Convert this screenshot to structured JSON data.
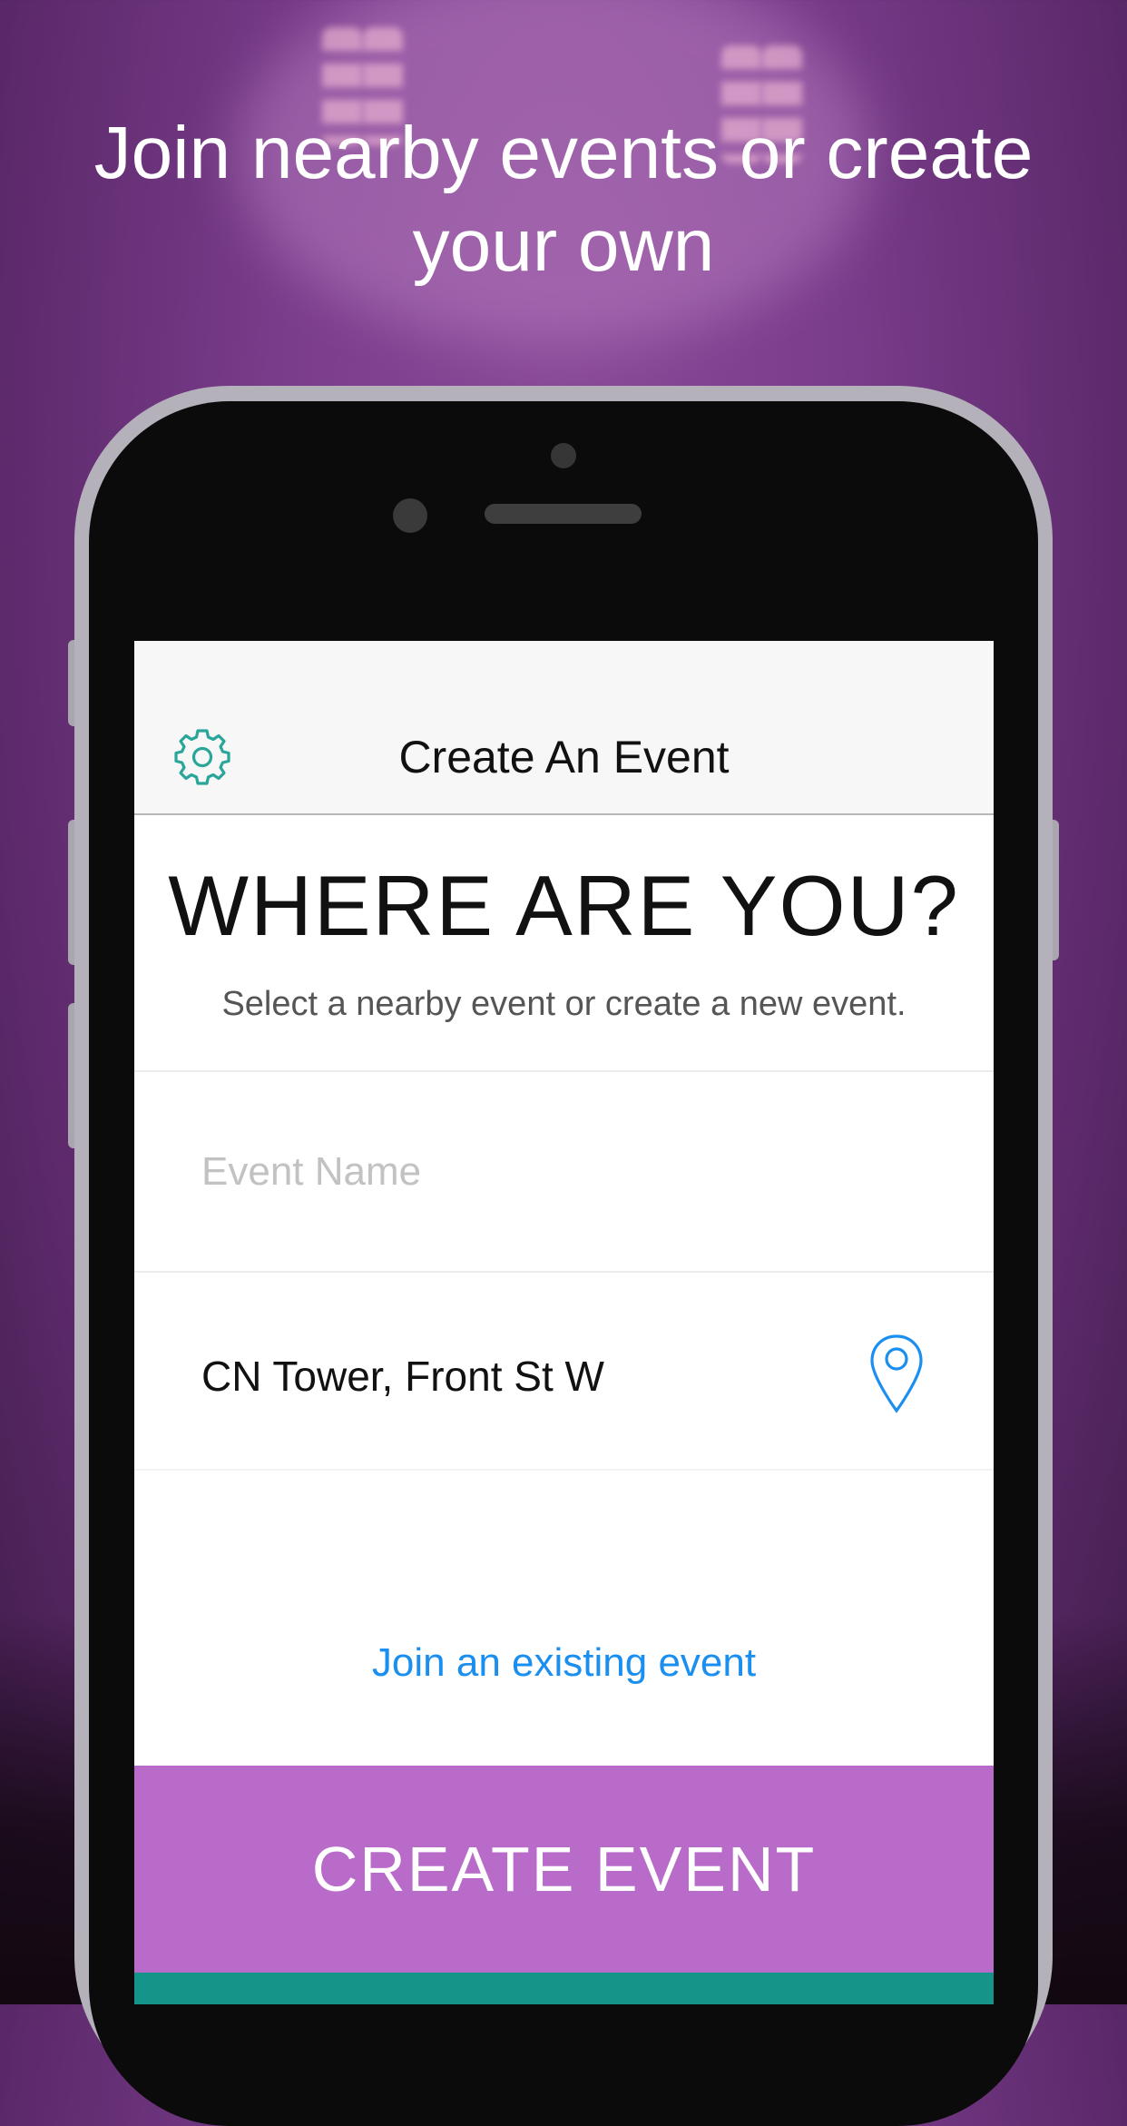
{
  "headline": "Join nearby events or create your own",
  "navbar": {
    "title": "Create An Event",
    "settings_icon": "gear-icon",
    "accent": "#2aa59a"
  },
  "main": {
    "title": "WHERE ARE YOU?",
    "subtitle": "Select a nearby event or create a new event."
  },
  "form": {
    "event_name_placeholder": "Event Name",
    "event_name_value": "",
    "location_value": "CN Tower, Front St W",
    "location_icon": "map-pin-icon"
  },
  "join_link": "Join an existing event",
  "create_button": "CREATE EVENT",
  "colors": {
    "create_button_bg": "#b86bc8",
    "link": "#1b8ff0",
    "footer_bar": "#15958a"
  }
}
